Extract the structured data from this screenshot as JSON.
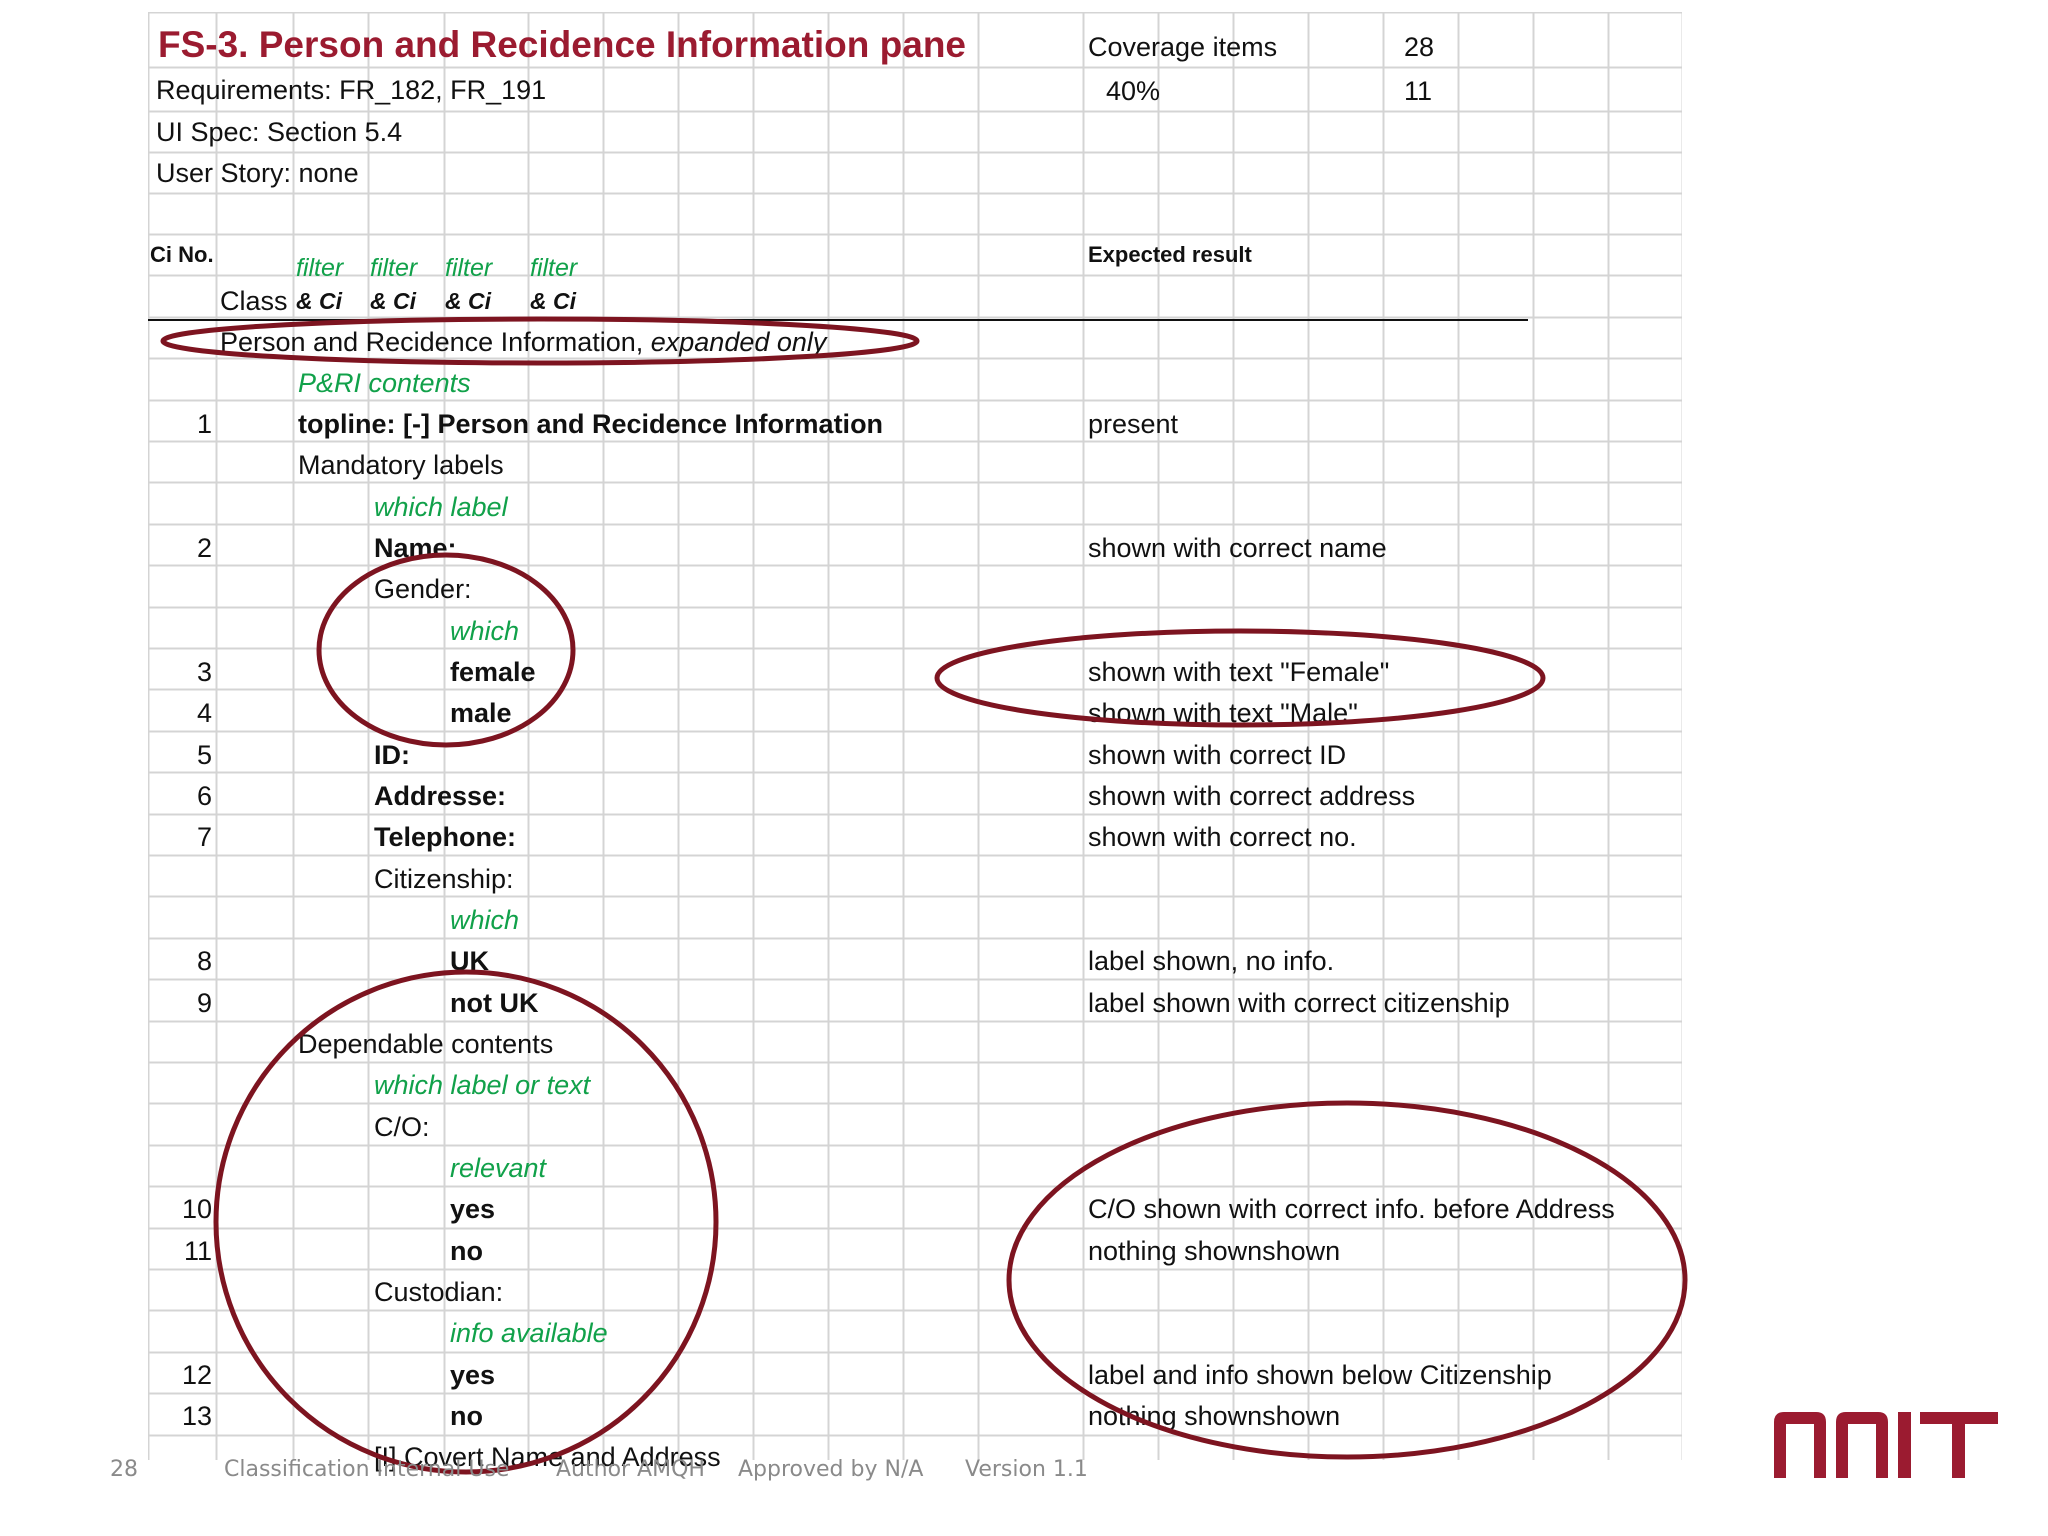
{
  "header": {
    "title": "FS-3. Person and Recidence Information pane",
    "requirements": "Requirements: FR_182, FR_191",
    "ui_spec": "UI Spec: Section 5.4",
    "user_story": "User Story: none",
    "coverage_label": "Coverage items",
    "coverage_count": "28",
    "coverage_pct": "40%",
    "coverage_done": "11"
  },
  "columns": {
    "ci_no": "Ci No.",
    "class": "Class",
    "filter": "filter",
    "and_ci": "& Ci",
    "expected": "Expected result"
  },
  "rows": [
    {
      "no": "",
      "text": "Person and Recidence Information, ",
      "text_em": "expanded only",
      "expected": ""
    },
    {
      "no": "",
      "text": "P&RI contents",
      "expected": ""
    },
    {
      "no": "1",
      "text": "topline: [-]  Person and Recidence Information",
      "expected": "present"
    },
    {
      "no": "",
      "text": "Mandatory labels",
      "expected": ""
    },
    {
      "no": "",
      "text": "which label",
      "expected": ""
    },
    {
      "no": "2",
      "text": "Name:",
      "expected": "shown with correct name"
    },
    {
      "no": "",
      "text": "Gender:",
      "expected": ""
    },
    {
      "no": "",
      "text": "which",
      "expected": ""
    },
    {
      "no": "3",
      "text": "female",
      "expected": "shown with text \"Female\""
    },
    {
      "no": "4",
      "text": "male",
      "expected": "shown with text \"Male\""
    },
    {
      "no": "5",
      "text": "ID:",
      "expected": "shown with correct ID"
    },
    {
      "no": "6",
      "text": "Addresse:",
      "expected": "shown with correct address"
    },
    {
      "no": "7",
      "text": "Telephone:",
      "expected": "shown with correct no."
    },
    {
      "no": "",
      "text": "Citizenship:",
      "expected": ""
    },
    {
      "no": "",
      "text": "which",
      "expected": ""
    },
    {
      "no": "8",
      "text": "UK",
      "expected": "label shown, no info."
    },
    {
      "no": "9",
      "text": "not UK",
      "expected": "label shown with correct citizenship"
    },
    {
      "no": "",
      "text": "Dependable contents",
      "expected": ""
    },
    {
      "no": "",
      "text": "which label or text",
      "expected": ""
    },
    {
      "no": "",
      "text": "C/O:",
      "expected": ""
    },
    {
      "no": "",
      "text": "relevant",
      "expected": ""
    },
    {
      "no": "10",
      "text": "yes",
      "expected": "C/O shown with correct info. before Address"
    },
    {
      "no": "11",
      "text": "no",
      "expected": "nothing shownshown"
    },
    {
      "no": "",
      "text": "Custodian:",
      "expected": ""
    },
    {
      "no": "",
      "text": "info available",
      "expected": ""
    },
    {
      "no": "12",
      "text": "yes",
      "expected": "label and info shown below Citizenship"
    },
    {
      "no": "13",
      "text": "no",
      "expected": "nothing shownshown"
    },
    {
      "no": "",
      "text": "[I] Covert Name and Address",
      "expected": ""
    }
  ],
  "footer": {
    "page": "28",
    "classification": "Classification Internal Use",
    "author": "Author AMQH",
    "approved": "Approved by N/A",
    "version": "Version 1.1"
  },
  "logo": {
    "text": "NNIT",
    "color": "#9b1b30"
  },
  "colors": {
    "title": "#9b1b30",
    "filter_text": "#11a14a",
    "annotation": "#7d1420",
    "grid": "#d4d4d4"
  }
}
